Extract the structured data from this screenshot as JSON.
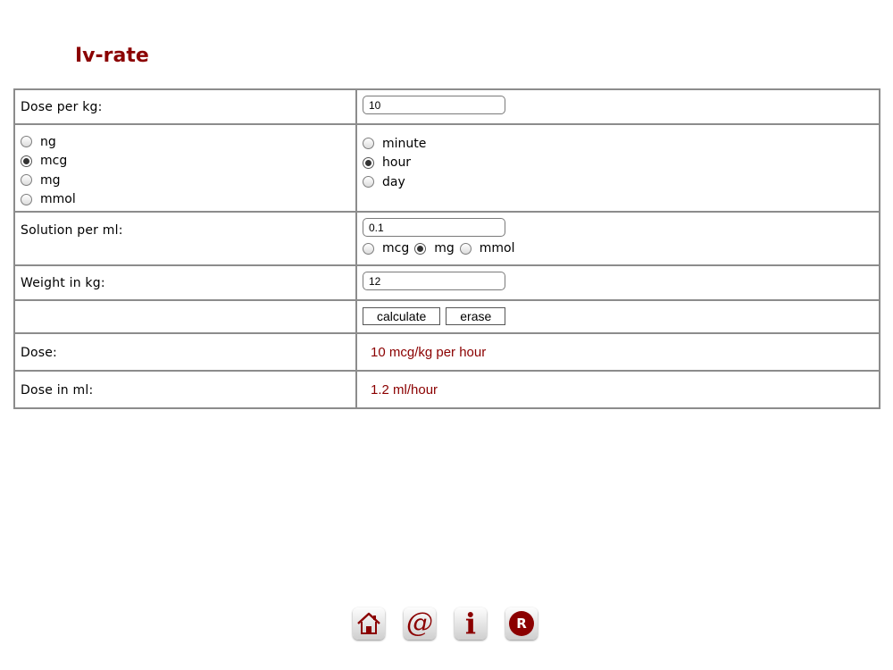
{
  "page": {
    "title": "Iv-rate"
  },
  "form": {
    "dose_per_kg": {
      "label": "Dose per kg:",
      "value": "10"
    },
    "dose_units": [
      {
        "label": "ng",
        "selected": false
      },
      {
        "label": "mcg",
        "selected": true
      },
      {
        "label": "mg",
        "selected": false
      },
      {
        "label": "mmol",
        "selected": false
      }
    ],
    "time_units": [
      {
        "label": "minute",
        "selected": false
      },
      {
        "label": "hour",
        "selected": true
      },
      {
        "label": "day",
        "selected": false
      }
    ],
    "solution_per_ml": {
      "label": "Solution per ml:",
      "value": "0.1",
      "units": [
        {
          "label": "mcg",
          "selected": false
        },
        {
          "label": "mg",
          "selected": true
        },
        {
          "label": "mmol",
          "selected": false
        }
      ]
    },
    "weight_in_kg": {
      "label": "Weight in kg:",
      "value": "12"
    },
    "buttons": {
      "calculate": "calculate",
      "erase": "erase"
    },
    "results": {
      "dose_label": "Dose:",
      "dose_value": "10 mcg/kg per hour",
      "dose_ml_label": "Dose in ml:",
      "dose_ml_value": "1.2 ml/hour"
    }
  },
  "footer": {
    "icons": [
      "home-icon",
      "email-icon",
      "info-icon",
      "registered-icon"
    ],
    "at_glyph": "@",
    "info_glyph": "i",
    "registered_glyph": "R"
  },
  "colors": {
    "accent": "#8b0000",
    "border": "#8c8c8c"
  }
}
